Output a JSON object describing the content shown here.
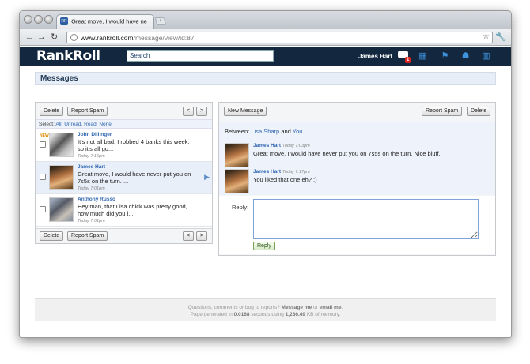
{
  "browser": {
    "tab_title": "Great move, I would have ne",
    "favicon_text": "RR",
    "url_host": "www.rankroll.com",
    "url_path": "/message/view/id:87"
  },
  "site": {
    "logo": "RankRoll",
    "search_value": "Search",
    "username": "James Hart",
    "notification_count": "1",
    "colors": {
      "header_bg": "#13273f",
      "link": "#2f66b0",
      "icon_blue": "#3f92dc"
    }
  },
  "messages_page": {
    "title": "Messages",
    "left_panel": {
      "delete_label": "Delete",
      "report_spam_label": "Report Spam",
      "prev_label": "<",
      "next_label": ">",
      "select_label": "Select:",
      "select_options": [
        "All",
        "Unread",
        "Read",
        "None"
      ],
      "new_badge": "NEW",
      "items": [
        {
          "sender": "John Dillinger",
          "snippet_1": "It's not all bad, I robbed 4 banks this week,",
          "snippet_2": "so it's all go...",
          "time": "Today 7:16pm"
        },
        {
          "sender": "James Hart",
          "snippet_1": "Great move, I would have never put you on",
          "snippet_2": "7s5s on the turn. ...",
          "time": "Today 7:01pm"
        },
        {
          "sender": "Anthony Russo",
          "snippet_1": "Hey man, that Lisa chick was pretty good,",
          "snippet_2": "how much did you l...",
          "time": "Today 7:01pm"
        }
      ]
    },
    "right_panel": {
      "new_message_label": "New Message",
      "report_spam_label": "Report Spam",
      "delete_label": "Delete",
      "between_label": "Between:",
      "participant_1": "Lisa Sharp",
      "and_label": "and",
      "participant_2": "You",
      "conversation": [
        {
          "sender": "James Hart",
          "time": "Today 7:03pm",
          "text": "Great move, I would have never put you on 7s5s on the turn. Nice bluff."
        },
        {
          "sender": "James Hart",
          "time": "Today 7:17pm",
          "text": "You liked that one eh? ;)"
        }
      ],
      "reply_label": "Reply:",
      "reply_button": "Reply"
    }
  },
  "footer": {
    "line1_a": "Questions, comments or bug to reports?",
    "message_me": "Message me",
    "or": "or",
    "email_me": "email me",
    "line2_a": "Page generated in",
    "gen_time": "0.0168",
    "line2_b": "seconds using",
    "memory": "1,286.49",
    "line2_c": "KB of memory."
  }
}
